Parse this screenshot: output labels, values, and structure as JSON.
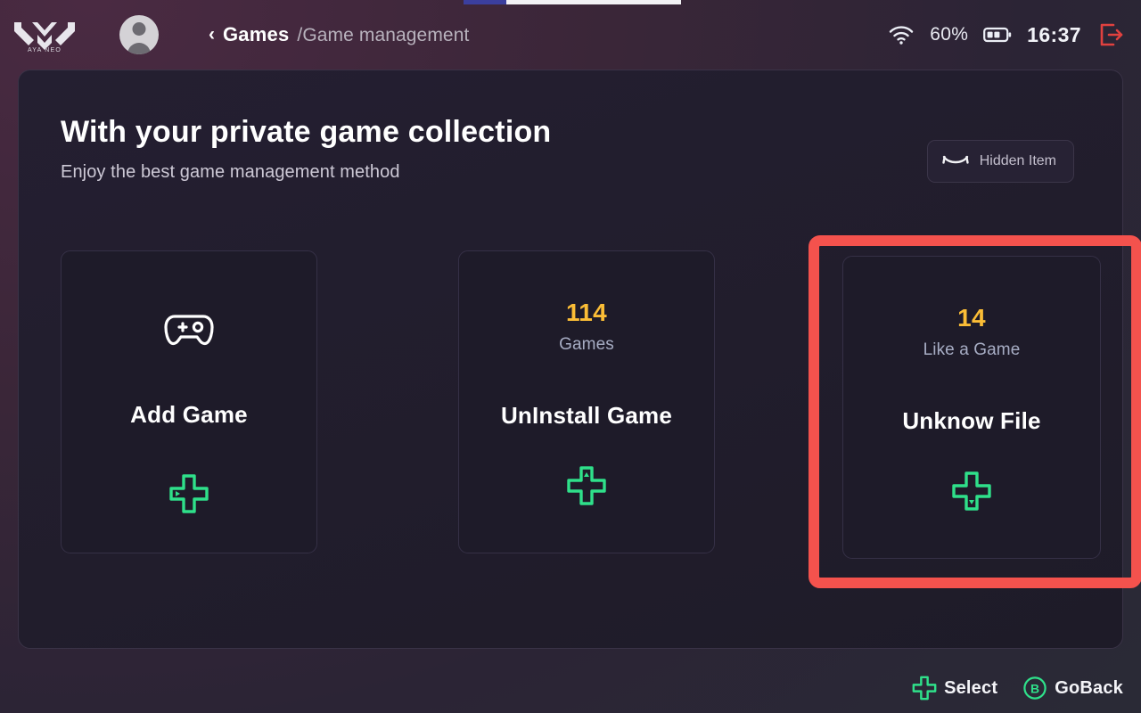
{
  "header": {
    "brand_logo": "aya-neo-logo",
    "brand_name": "AYA NEO",
    "avatar": "user-avatar-icon",
    "breadcrumb": {
      "back_chevron": "‹",
      "current": "Games",
      "path": "/Game management"
    },
    "status": {
      "wifi_icon": "wifi-icon",
      "battery_percent": "60%",
      "battery_icon": "battery-icon",
      "time": "16:37",
      "power_icon": "power-exit-icon"
    }
  },
  "top_strip": {
    "segment_a_color": "#3b3f9e",
    "segment_b_color": "#f2f2f5"
  },
  "panel": {
    "title": "With your private game collection",
    "subtitle": "Enjoy the best game management method",
    "hidden_item": {
      "icon": "eye-closed-icon",
      "label": "Hidden Item"
    }
  },
  "cards": [
    {
      "id": "add-game",
      "count": null,
      "count_label": null,
      "title": "Add Game",
      "top_icon": "gamepad-icon",
      "dpad_icon": "dpad-left-icon",
      "selected": false
    },
    {
      "id": "uninstall-game",
      "count": "114",
      "count_label": "Games",
      "title": "UnInstall Game",
      "top_icon": null,
      "dpad_icon": "dpad-up-icon",
      "selected": false
    },
    {
      "id": "unknow-file",
      "count": "14",
      "count_label": "Like a Game",
      "title": "Unknow File",
      "top_icon": null,
      "dpad_icon": "dpad-down-icon",
      "selected": true
    }
  ],
  "footer": {
    "select": {
      "icon": "dpad-icon",
      "label": "Select"
    },
    "goback": {
      "icon": "button-b-icon",
      "label": "GoBack"
    }
  },
  "colors": {
    "accent_green": "#2fe08a",
    "accent_yellow": "#fbbd36",
    "selection_red": "#f4524d",
    "panel_bg": "#211d2c",
    "card_bg": "#1e1b29"
  }
}
